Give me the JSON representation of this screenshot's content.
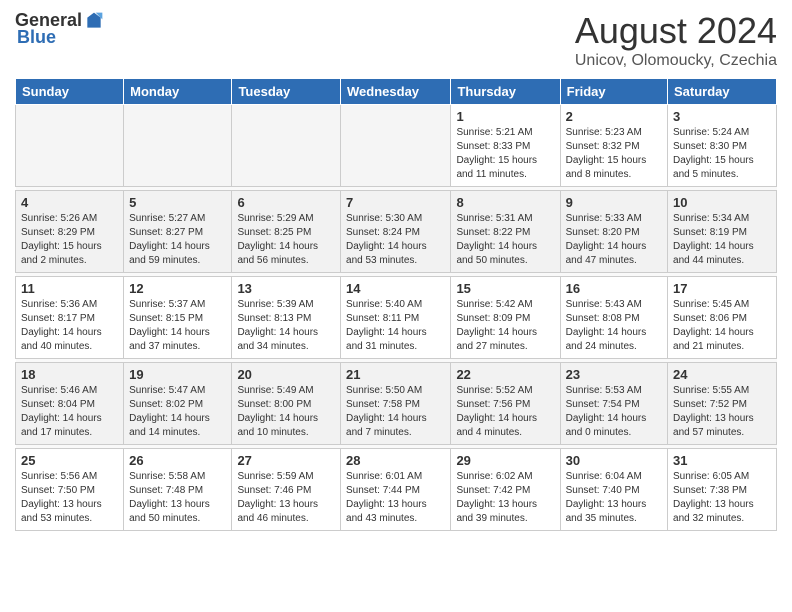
{
  "logo": {
    "general": "General",
    "blue": "Blue"
  },
  "title": "August 2024",
  "subtitle": "Unicov, Olomoucky, Czechia",
  "headers": [
    "Sunday",
    "Monday",
    "Tuesday",
    "Wednesday",
    "Thursday",
    "Friday",
    "Saturday"
  ],
  "weeks": [
    [
      {
        "day": "",
        "info": ""
      },
      {
        "day": "",
        "info": ""
      },
      {
        "day": "",
        "info": ""
      },
      {
        "day": "",
        "info": ""
      },
      {
        "day": "1",
        "info": "Sunrise: 5:21 AM\nSunset: 8:33 PM\nDaylight: 15 hours\nand 11 minutes."
      },
      {
        "day": "2",
        "info": "Sunrise: 5:23 AM\nSunset: 8:32 PM\nDaylight: 15 hours\nand 8 minutes."
      },
      {
        "day": "3",
        "info": "Sunrise: 5:24 AM\nSunset: 8:30 PM\nDaylight: 15 hours\nand 5 minutes."
      }
    ],
    [
      {
        "day": "4",
        "info": "Sunrise: 5:26 AM\nSunset: 8:29 PM\nDaylight: 15 hours\nand 2 minutes."
      },
      {
        "day": "5",
        "info": "Sunrise: 5:27 AM\nSunset: 8:27 PM\nDaylight: 14 hours\nand 59 minutes."
      },
      {
        "day": "6",
        "info": "Sunrise: 5:29 AM\nSunset: 8:25 PM\nDaylight: 14 hours\nand 56 minutes."
      },
      {
        "day": "7",
        "info": "Sunrise: 5:30 AM\nSunset: 8:24 PM\nDaylight: 14 hours\nand 53 minutes."
      },
      {
        "day": "8",
        "info": "Sunrise: 5:31 AM\nSunset: 8:22 PM\nDaylight: 14 hours\nand 50 minutes."
      },
      {
        "day": "9",
        "info": "Sunrise: 5:33 AM\nSunset: 8:20 PM\nDaylight: 14 hours\nand 47 minutes."
      },
      {
        "day": "10",
        "info": "Sunrise: 5:34 AM\nSunset: 8:19 PM\nDaylight: 14 hours\nand 44 minutes."
      }
    ],
    [
      {
        "day": "11",
        "info": "Sunrise: 5:36 AM\nSunset: 8:17 PM\nDaylight: 14 hours\nand 40 minutes."
      },
      {
        "day": "12",
        "info": "Sunrise: 5:37 AM\nSunset: 8:15 PM\nDaylight: 14 hours\nand 37 minutes."
      },
      {
        "day": "13",
        "info": "Sunrise: 5:39 AM\nSunset: 8:13 PM\nDaylight: 14 hours\nand 34 minutes."
      },
      {
        "day": "14",
        "info": "Sunrise: 5:40 AM\nSunset: 8:11 PM\nDaylight: 14 hours\nand 31 minutes."
      },
      {
        "day": "15",
        "info": "Sunrise: 5:42 AM\nSunset: 8:09 PM\nDaylight: 14 hours\nand 27 minutes."
      },
      {
        "day": "16",
        "info": "Sunrise: 5:43 AM\nSunset: 8:08 PM\nDaylight: 14 hours\nand 24 minutes."
      },
      {
        "day": "17",
        "info": "Sunrise: 5:45 AM\nSunset: 8:06 PM\nDaylight: 14 hours\nand 21 minutes."
      }
    ],
    [
      {
        "day": "18",
        "info": "Sunrise: 5:46 AM\nSunset: 8:04 PM\nDaylight: 14 hours\nand 17 minutes."
      },
      {
        "day": "19",
        "info": "Sunrise: 5:47 AM\nSunset: 8:02 PM\nDaylight: 14 hours\nand 14 minutes."
      },
      {
        "day": "20",
        "info": "Sunrise: 5:49 AM\nSunset: 8:00 PM\nDaylight: 14 hours\nand 10 minutes."
      },
      {
        "day": "21",
        "info": "Sunrise: 5:50 AM\nSunset: 7:58 PM\nDaylight: 14 hours\nand 7 minutes."
      },
      {
        "day": "22",
        "info": "Sunrise: 5:52 AM\nSunset: 7:56 PM\nDaylight: 14 hours\nand 4 minutes."
      },
      {
        "day": "23",
        "info": "Sunrise: 5:53 AM\nSunset: 7:54 PM\nDaylight: 14 hours\nand 0 minutes."
      },
      {
        "day": "24",
        "info": "Sunrise: 5:55 AM\nSunset: 7:52 PM\nDaylight: 13 hours\nand 57 minutes."
      }
    ],
    [
      {
        "day": "25",
        "info": "Sunrise: 5:56 AM\nSunset: 7:50 PM\nDaylight: 13 hours\nand 53 minutes."
      },
      {
        "day": "26",
        "info": "Sunrise: 5:58 AM\nSunset: 7:48 PM\nDaylight: 13 hours\nand 50 minutes."
      },
      {
        "day": "27",
        "info": "Sunrise: 5:59 AM\nSunset: 7:46 PM\nDaylight: 13 hours\nand 46 minutes."
      },
      {
        "day": "28",
        "info": "Sunrise: 6:01 AM\nSunset: 7:44 PM\nDaylight: 13 hours\nand 43 minutes."
      },
      {
        "day": "29",
        "info": "Sunrise: 6:02 AM\nSunset: 7:42 PM\nDaylight: 13 hours\nand 39 minutes."
      },
      {
        "day": "30",
        "info": "Sunrise: 6:04 AM\nSunset: 7:40 PM\nDaylight: 13 hours\nand 35 minutes."
      },
      {
        "day": "31",
        "info": "Sunrise: 6:05 AM\nSunset: 7:38 PM\nDaylight: 13 hours\nand 32 minutes."
      }
    ]
  ]
}
